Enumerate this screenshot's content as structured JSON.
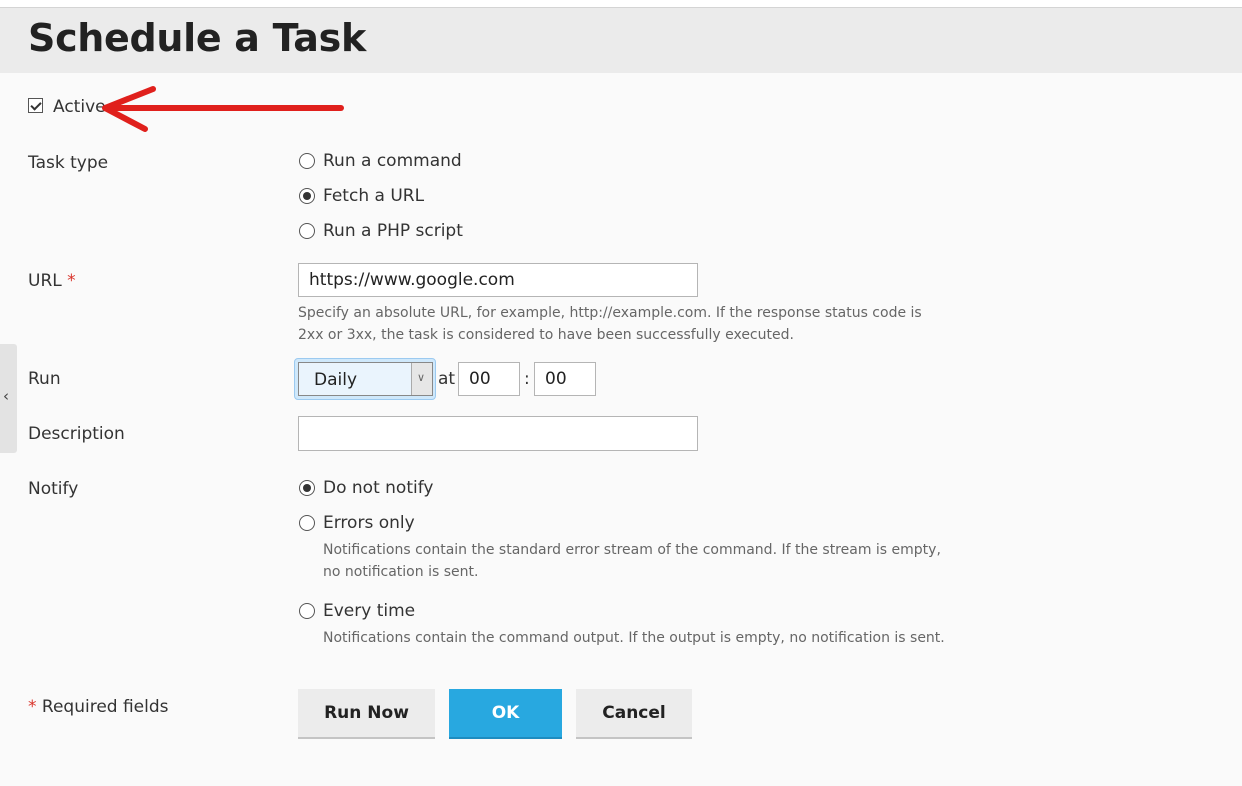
{
  "page": {
    "title": "Schedule a Task"
  },
  "active": {
    "label": "Active",
    "checked": true
  },
  "task_type": {
    "label": "Task type",
    "options": [
      "Run a command",
      "Fetch a URL",
      "Run a PHP script"
    ],
    "selected": "Fetch a URL"
  },
  "url": {
    "label": "URL",
    "required_mark": "*",
    "value": "https://www.google.com",
    "hint_line1": "Specify an absolute URL, for example, http://example.com. If the response status code is",
    "hint_line2": "2xx or 3xx, the task is considered to have been successfully executed."
  },
  "run": {
    "label": "Run",
    "frequency": "Daily",
    "at_label": "at",
    "hour": "00",
    "separator": ":",
    "minute": "00"
  },
  "description": {
    "label": "Description",
    "value": ""
  },
  "notify": {
    "label": "Notify",
    "options": {
      "do_not_notify": "Do not notify",
      "errors_only": "Errors only",
      "every_time": "Every time"
    },
    "errors_hint_line1": "Notifications contain the standard error stream of the command. If the stream is empty,",
    "errors_hint_line2": "no notification is sent.",
    "every_time_hint": "Notifications contain the command output. If the output is empty, no notification is sent.",
    "selected": "Do not notify"
  },
  "footer": {
    "required_mark": "*",
    "required_text": " Required fields",
    "run_now": "Run Now",
    "ok": "OK",
    "cancel": "Cancel"
  },
  "sidebar_toggle": {
    "icon": "chevron-left-icon",
    "glyph": "‹"
  },
  "annotation": {
    "icon": "red-arrow-icon",
    "color": "#e0201c"
  },
  "colors": {
    "primary_button": "#28a8e0",
    "required": "#d9342b"
  }
}
